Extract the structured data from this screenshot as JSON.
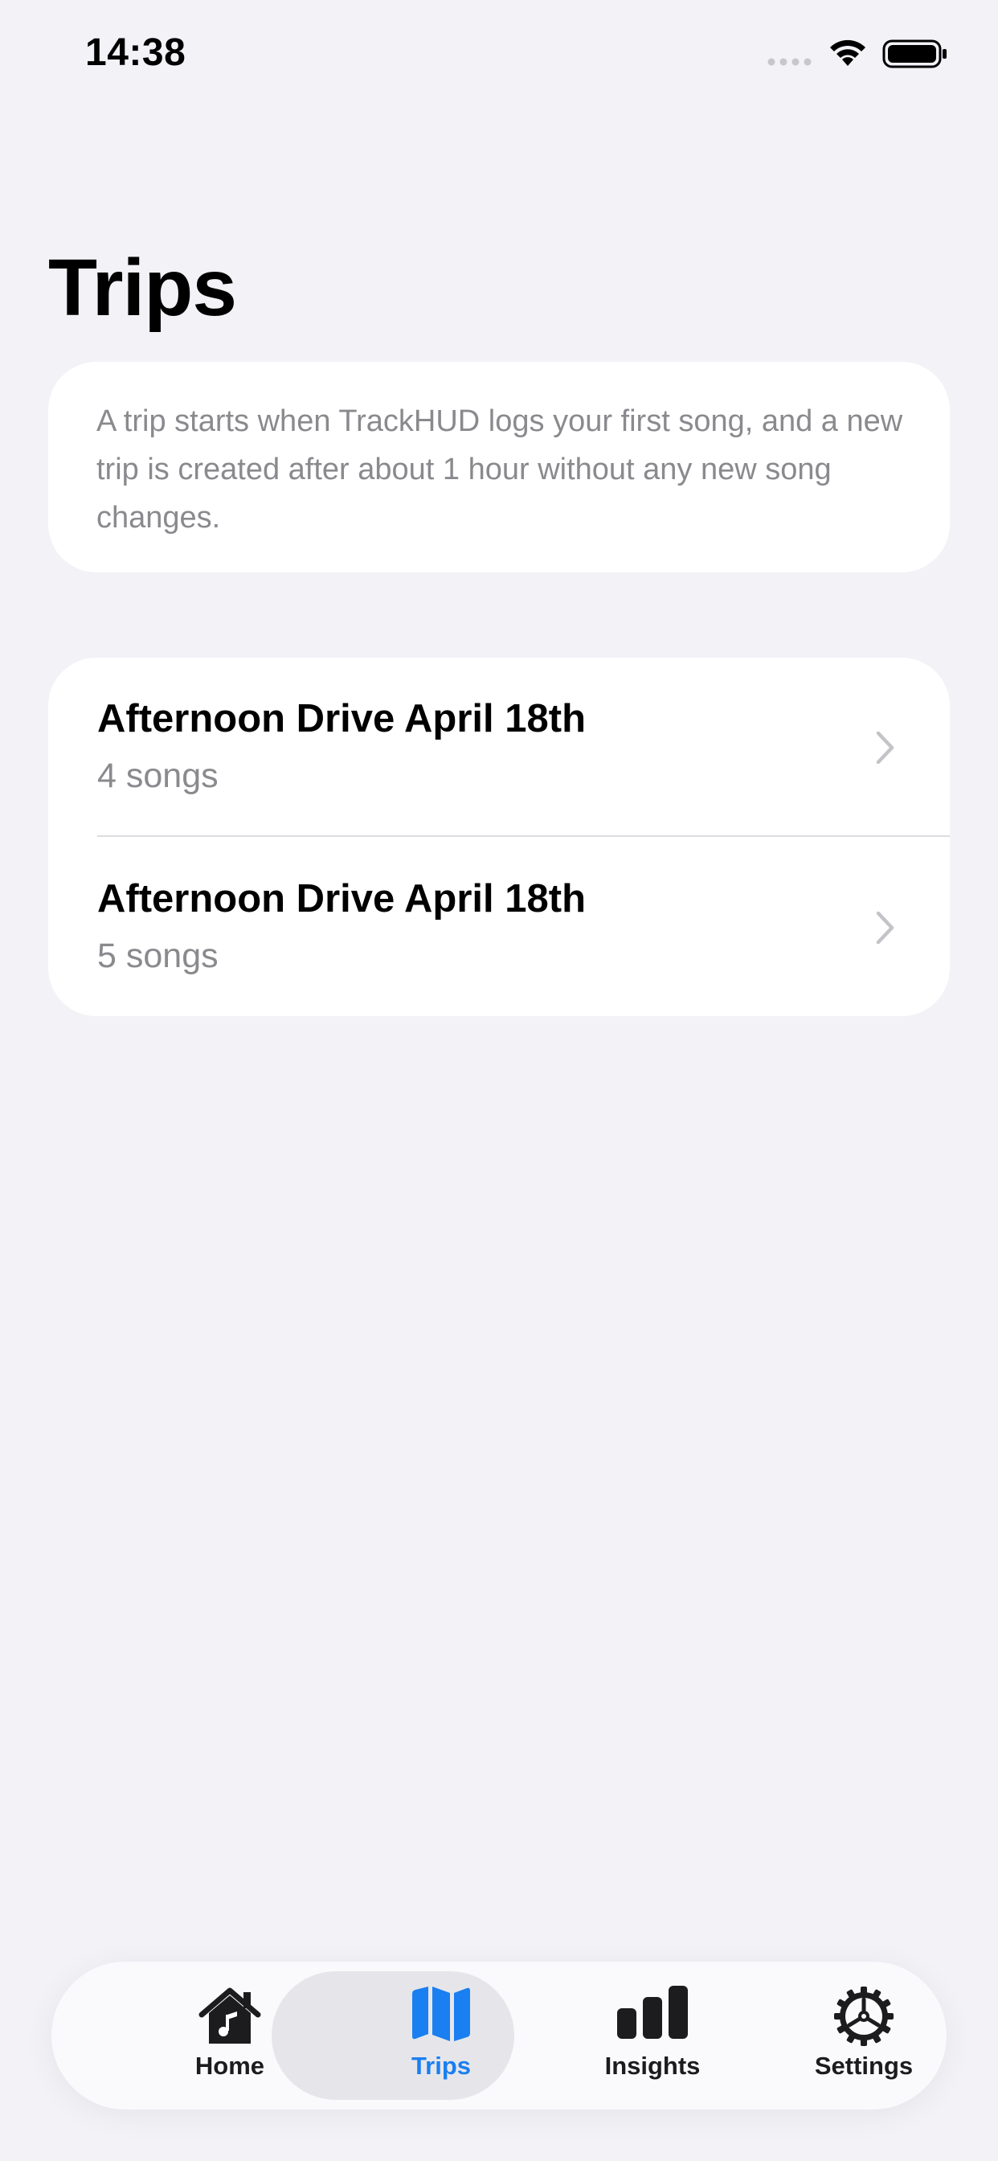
{
  "status_bar": {
    "time": "14:38",
    "signal_icon": "signal-dots-icon",
    "wifi_icon": "wifi-icon",
    "battery_icon": "battery-icon"
  },
  "page": {
    "title": "Trips"
  },
  "info": {
    "text": "A trip starts when TrackHUD logs your first song, and a new trip is created after about 1 hour without any new song changes."
  },
  "trips": [
    {
      "title": "Afternoon Drive April 18th",
      "subtitle": "4 songs"
    },
    {
      "title": "Afternoon Drive April 18th",
      "subtitle": "5 songs"
    }
  ],
  "tab_bar": {
    "active_color": "#1a7ff0",
    "tabs": [
      {
        "label": "Home",
        "icon": "home-music-icon",
        "active": false
      },
      {
        "label": "Trips",
        "icon": "map-icon",
        "active": true
      },
      {
        "label": "Insights",
        "icon": "bar-chart-icon",
        "active": false
      },
      {
        "label": "Settings",
        "icon": "gear-icon",
        "active": false
      }
    ]
  }
}
